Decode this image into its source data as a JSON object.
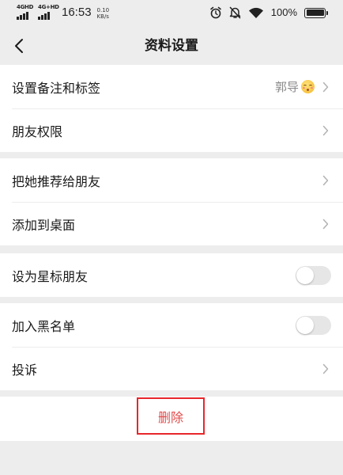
{
  "status_bar": {
    "network_1": "4GHD",
    "network_2": "4G+HD",
    "time": "16:53",
    "speed_value": "0.10",
    "speed_unit": "KB/s",
    "battery_percent": "100%",
    "battery_level": 1.0,
    "icons": [
      "alarm-icon",
      "mute-icon",
      "wifi-icon",
      "battery-icon"
    ]
  },
  "nav": {
    "title": "资料设置",
    "back_icon": "chevron-left-icon"
  },
  "rows": {
    "remark": {
      "label": "设置备注和标签",
      "value": "郭导",
      "emoji": "kissing-face-emoji"
    },
    "permissions": {
      "label": "朋友权限"
    },
    "recommend": {
      "label": "把她推荐给朋友"
    },
    "add_desktop": {
      "label": "添加到桌面"
    },
    "star": {
      "label": "设为星标朋友",
      "toggle_on": false
    },
    "blacklist": {
      "label": "加入黑名单",
      "toggle_on": false
    },
    "complain": {
      "label": "投诉"
    }
  },
  "delete": {
    "label": "删除",
    "color": "#e24b4b",
    "highlight_color": "#e8262a"
  },
  "colors": {
    "background": "#ededed",
    "card": "#ffffff",
    "text": "#1a1a1a",
    "secondary_text": "#8a8a8a"
  }
}
